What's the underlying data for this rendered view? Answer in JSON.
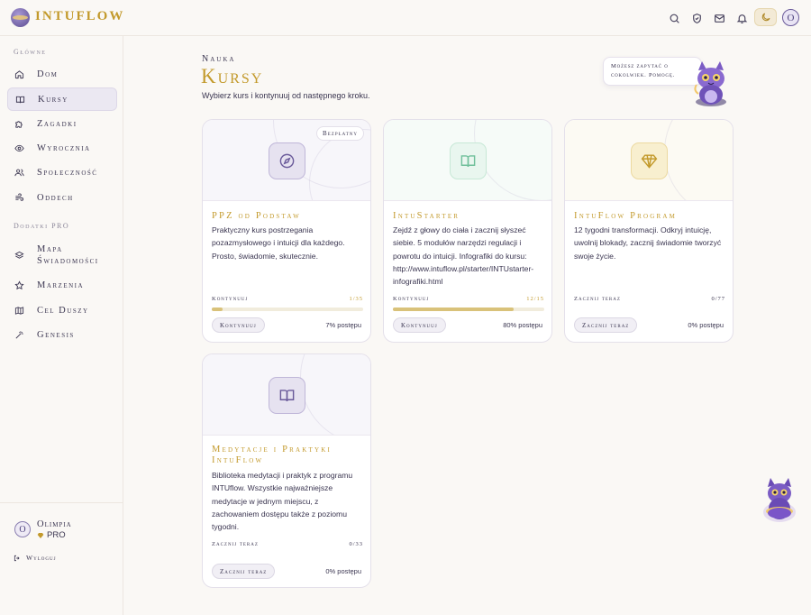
{
  "app": {
    "name": "INTUFLOW",
    "logo_icon": "crescent-logo-icon"
  },
  "header": {
    "icons": [
      "search-icon",
      "shield-icon",
      "mail-icon",
      "bell-icon"
    ],
    "theme_icon": "moon-icon",
    "avatar_initial": "O"
  },
  "sidebar": {
    "section_main": "Główne",
    "main_items": [
      {
        "label": "Dom",
        "icon": "home-icon",
        "active": false
      },
      {
        "label": "Kursy",
        "icon": "book-icon",
        "active": true
      },
      {
        "label": "Zagadki",
        "icon": "puzzle-icon",
        "active": false
      },
      {
        "label": "Wyrocznia",
        "icon": "eye-icon",
        "active": false
      },
      {
        "label": "Społeczność",
        "icon": "users-icon",
        "active": false
      },
      {
        "label": "Oddech",
        "icon": "wind-icon",
        "active": false
      }
    ],
    "section_pro": "Dodatki PRO",
    "pro_items": [
      {
        "label": "Mapa Świadomości",
        "icon": "layers-icon"
      },
      {
        "label": "Marzenia",
        "icon": "star-icon"
      },
      {
        "label": "Cel Duszy",
        "icon": "map-icon"
      },
      {
        "label": "Genesis",
        "icon": "wand-icon"
      }
    ],
    "user": {
      "initial": "O",
      "name": "Olimpia",
      "plan": "PRO",
      "plan_icon": "diamond-icon"
    },
    "logout": "Wyloguj"
  },
  "page": {
    "eyebrow": "Nauka",
    "title": "Kursy",
    "subtitle": "Wybierz kurs i kontynuuj od następnego kroku."
  },
  "assistant": {
    "bubble": "Możesz zapytać o cokolwiek. Pomogę.",
    "mascot_icon": "cat-mascot-icon"
  },
  "courses": [
    {
      "badge": "Bezpłatny",
      "title": "PPZ od Podstaw",
      "icon": "compass-icon",
      "description": "Praktyczny kurs postrzegania pozazmysłowego i intuicji dla każdego. Prosto, świadomie, skutecznie.",
      "status_label": "Kontynuuj",
      "count": "1/35",
      "progress": 7,
      "button": "Kontynuuj",
      "percent_text": "7% postępu",
      "accent": "#6a5a9a"
    },
    {
      "badge": "",
      "title": "IntuStarter",
      "icon": "open-book-icon",
      "description": "Zejdź z głowy do ciała i zacznij słyszeć siebie. 5 modułów narzędzi regulacji i powrotu do intuicji. Infografiki do kursu: http://www.intuflow.pl/starter/INTUstarter-infografiki.html",
      "status_label": "Kontynuuj",
      "count": "12/15",
      "progress": 80,
      "button": "Kontynuuj",
      "percent_text": "80% postępu",
      "accent": "#6fbf9a"
    },
    {
      "badge": "",
      "title": "IntuFlow Program",
      "icon": "diamond-icon",
      "description": "12 tygodni transformacji. Odkryj intuicję, uwolnij blokady, zacznij świadomie tworzyć swoje życie.",
      "status_label": "Zacznij teraz",
      "count": "0/77",
      "progress": 0,
      "button": "Zacznij teraz",
      "percent_text": "0% postępu",
      "accent": "#c39a2c"
    },
    {
      "badge": "",
      "title": "Medytacje i Praktyki IntuFlow",
      "icon": "open-book-icon",
      "description": "Biblioteka medytacji i praktyk z programu INTUflow. Wszystkie najważniejsze medytacje w jednym miejscu, z zachowaniem dostępu także z poziomu tygodni.",
      "status_label": "Zacznij teraz",
      "count": "0/33",
      "progress": 0,
      "button": "Zacznij teraz",
      "percent_text": "0% postępu",
      "accent": "#6a5a9a"
    }
  ]
}
